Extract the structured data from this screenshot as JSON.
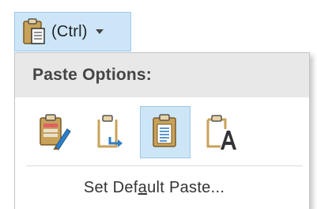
{
  "smart_tag": {
    "label": "(Ctrl)",
    "icon": "clipboard-paste-icon",
    "caret_icon": "caret-down-icon"
  },
  "menu": {
    "header": "Paste Options:",
    "options": [
      {
        "icon": "keep-source-formatting-icon",
        "selected": false
      },
      {
        "icon": "merge-formatting-icon",
        "selected": false
      },
      {
        "icon": "keep-text-only-icon",
        "selected": true
      },
      {
        "icon": "paste-picture-text-icon",
        "selected": false
      }
    ],
    "set_default_pre": "Set Def",
    "set_default_accel": "a",
    "set_default_post": "ult Paste..."
  },
  "colors": {
    "selected_bg": "#cde6f7",
    "header_bg": "#e8e8e8",
    "clipboard_tan": "#c9a25a",
    "accent_blue": "#2f7fc4"
  }
}
